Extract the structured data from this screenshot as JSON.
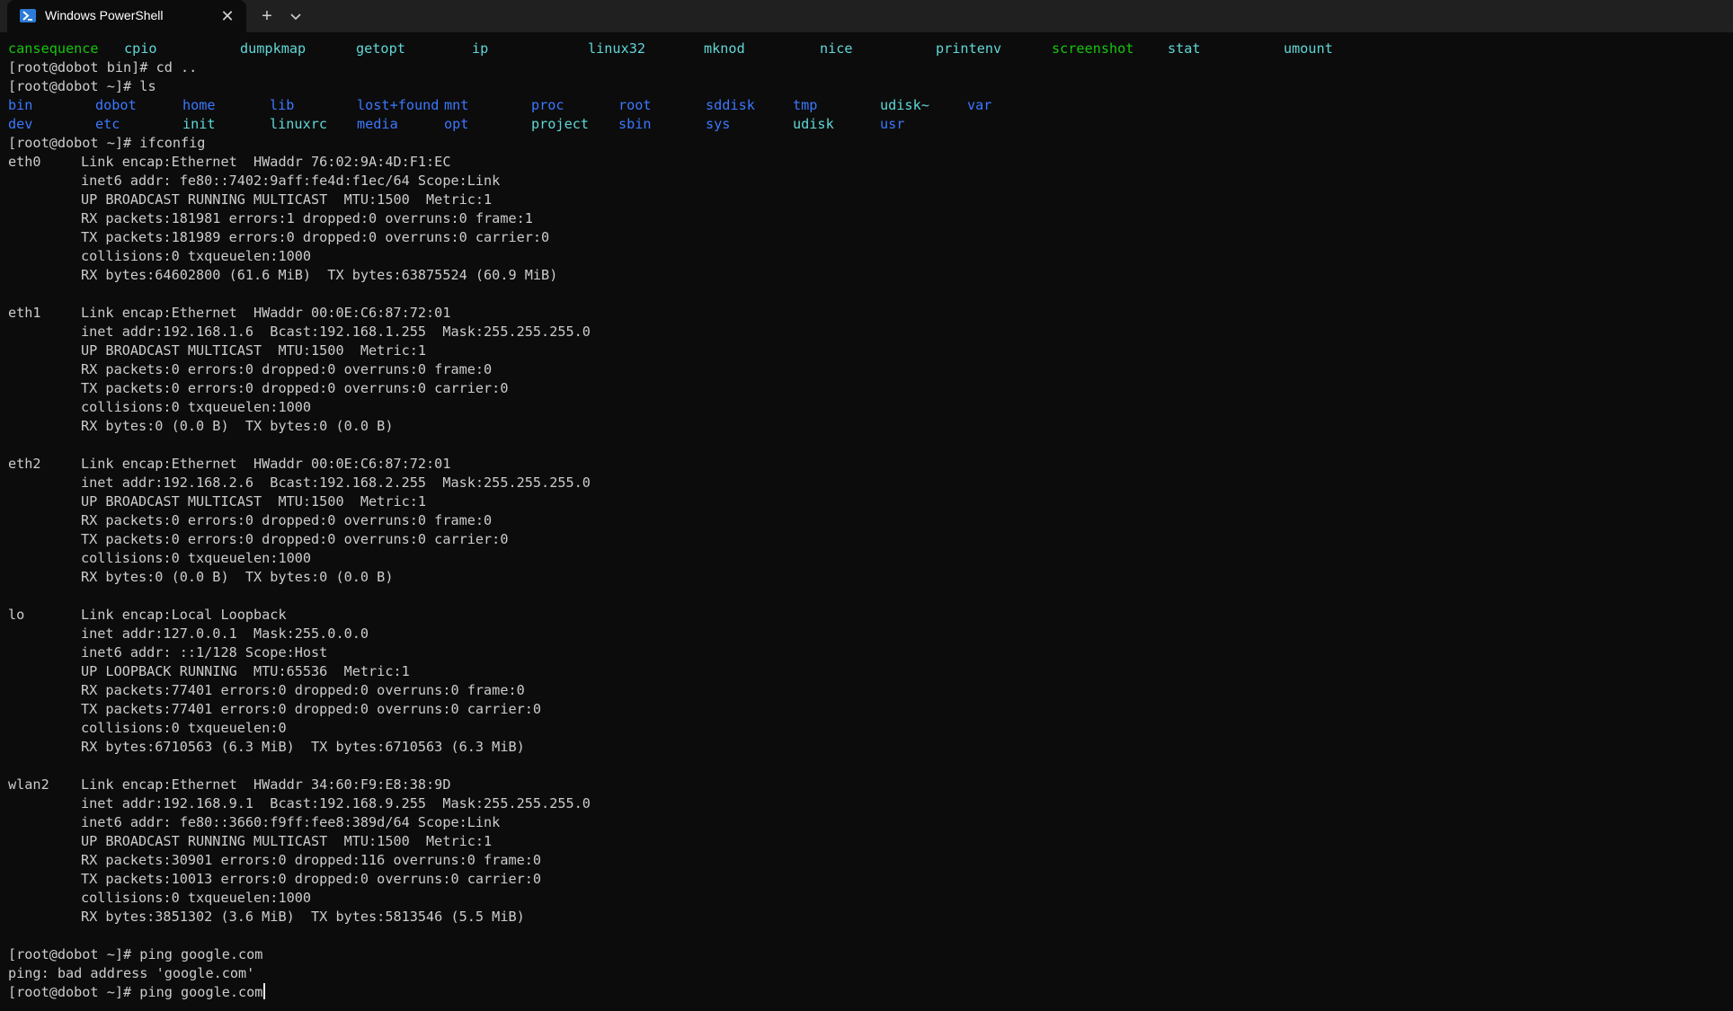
{
  "window": {
    "tab_title": "Windows PowerShell",
    "close_glyph": "✕",
    "new_tab_glyph": "+",
    "dropdown_icon": "chevron-down-icon",
    "colors": {
      "background": "#0c0c0c",
      "titlebar": "#202020",
      "text": "#cccccc",
      "dir_blue": "#3b78ff",
      "exec_green": "#16c60c",
      "link_teal": "#61d6d6"
    }
  },
  "bin_listing": [
    {
      "name": "cansequence",
      "kind": "green"
    },
    {
      "name": "cpio",
      "kind": "aqua"
    },
    {
      "name": "dumpkmap",
      "kind": "aqua"
    },
    {
      "name": "getopt",
      "kind": "aqua"
    },
    {
      "name": "ip",
      "kind": "aqua"
    },
    {
      "name": "linux32",
      "kind": "aqua"
    },
    {
      "name": "mknod",
      "kind": "aqua"
    },
    {
      "name": "nice",
      "kind": "aqua"
    },
    {
      "name": "printenv",
      "kind": "aqua"
    },
    {
      "name": "screenshot",
      "kind": "green"
    },
    {
      "name": "stat",
      "kind": "aqua"
    },
    {
      "name": "umount",
      "kind": "aqua"
    }
  ],
  "cmd_cd": "[root@dobot bin]# cd ..",
  "cmd_ls": "[root@dobot ~]# ls",
  "ls_row1": [
    {
      "name": "bin",
      "kind": "blue"
    },
    {
      "name": "dobot",
      "kind": "blue"
    },
    {
      "name": "home",
      "kind": "blue"
    },
    {
      "name": "lib",
      "kind": "blue"
    },
    {
      "name": "lost+found",
      "kind": "blue"
    },
    {
      "name": "mnt",
      "kind": "blue"
    },
    {
      "name": "proc",
      "kind": "blue"
    },
    {
      "name": "root",
      "kind": "blue"
    },
    {
      "name": "sddisk",
      "kind": "blue"
    },
    {
      "name": "tmp",
      "kind": "blue"
    },
    {
      "name": "udisk~",
      "kind": "aqua"
    },
    {
      "name": "var",
      "kind": "blue"
    }
  ],
  "ls_row2": [
    {
      "name": "dev",
      "kind": "blue"
    },
    {
      "name": "etc",
      "kind": "blue"
    },
    {
      "name": "init",
      "kind": "aqua"
    },
    {
      "name": "linuxrc",
      "kind": "aqua"
    },
    {
      "name": "media",
      "kind": "blue"
    },
    {
      "name": "opt",
      "kind": "blue"
    },
    {
      "name": "project",
      "kind": "aqua"
    },
    {
      "name": "sbin",
      "kind": "blue"
    },
    {
      "name": "sys",
      "kind": "blue"
    },
    {
      "name": "udisk",
      "kind": "aqua"
    },
    {
      "name": "usr",
      "kind": "blue"
    }
  ],
  "cmd_ifconfig": "[root@dobot ~]# ifconfig",
  "interfaces": [
    {
      "name": "eth0",
      "lines": [
        "Link encap:Ethernet  HWaddr 76:02:9A:4D:F1:EC",
        "inet6 addr: fe80::7402:9aff:fe4d:f1ec/64 Scope:Link",
        "UP BROADCAST RUNNING MULTICAST  MTU:1500  Metric:1",
        "RX packets:181981 errors:1 dropped:0 overruns:0 frame:1",
        "TX packets:181989 errors:0 dropped:0 overruns:0 carrier:0",
        "collisions:0 txqueuelen:1000",
        "RX bytes:64602800 (61.6 MiB)  TX bytes:63875524 (60.9 MiB)"
      ]
    },
    {
      "name": "eth1",
      "lines": [
        "Link encap:Ethernet  HWaddr 00:0E:C6:87:72:01",
        "inet addr:192.168.1.6  Bcast:192.168.1.255  Mask:255.255.255.0",
        "UP BROADCAST MULTICAST  MTU:1500  Metric:1",
        "RX packets:0 errors:0 dropped:0 overruns:0 frame:0",
        "TX packets:0 errors:0 dropped:0 overruns:0 carrier:0",
        "collisions:0 txqueuelen:1000",
        "RX bytes:0 (0.0 B)  TX bytes:0 (0.0 B)"
      ]
    },
    {
      "name": "eth2",
      "lines": [
        "Link encap:Ethernet  HWaddr 00:0E:C6:87:72:01",
        "inet addr:192.168.2.6  Bcast:192.168.2.255  Mask:255.255.255.0",
        "UP BROADCAST MULTICAST  MTU:1500  Metric:1",
        "RX packets:0 errors:0 dropped:0 overruns:0 frame:0",
        "TX packets:0 errors:0 dropped:0 overruns:0 carrier:0",
        "collisions:0 txqueuelen:1000",
        "RX bytes:0 (0.0 B)  TX bytes:0 (0.0 B)"
      ]
    },
    {
      "name": "lo",
      "lines": [
        "Link encap:Local Loopback",
        "inet addr:127.0.0.1  Mask:255.0.0.0",
        "inet6 addr: ::1/128 Scope:Host",
        "UP LOOPBACK RUNNING  MTU:65536  Metric:1",
        "RX packets:77401 errors:0 dropped:0 overruns:0 frame:0",
        "TX packets:77401 errors:0 dropped:0 overruns:0 carrier:0",
        "collisions:0 txqueuelen:0",
        "RX bytes:6710563 (6.3 MiB)  TX bytes:6710563 (6.3 MiB)"
      ]
    },
    {
      "name": "wlan2",
      "lines": [
        "Link encap:Ethernet  HWaddr 34:60:F9:E8:38:9D",
        "inet addr:192.168.9.1  Bcast:192.168.9.255  Mask:255.255.255.0",
        "inet6 addr: fe80::3660:f9ff:fee8:389d/64 Scope:Link",
        "UP BROADCAST RUNNING MULTICAST  MTU:1500  Metric:1",
        "RX packets:30901 errors:0 dropped:116 overruns:0 frame:0",
        "TX packets:10013 errors:0 dropped:0 overruns:0 carrier:0",
        "collisions:0 txqueuelen:1000",
        "RX bytes:3851302 (3.6 MiB)  TX bytes:5813546 (5.5 MiB)"
      ]
    }
  ],
  "cmd_ping1": "[root@dobot ~]# ping google.com",
  "ping_error": "ping: bad address 'google.com'",
  "cmd_ping2": "[root@dobot ~]# ping google.com"
}
